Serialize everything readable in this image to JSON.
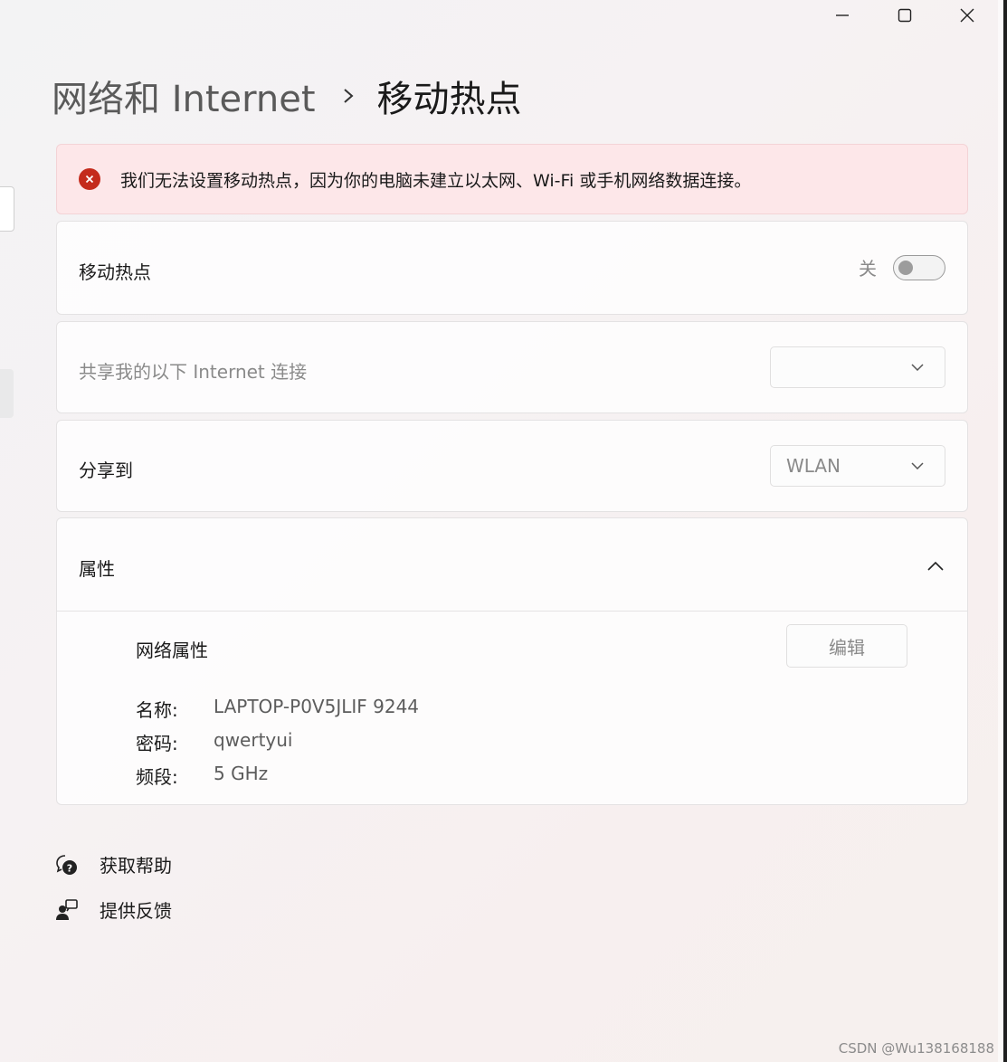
{
  "window_controls": {
    "icons": [
      "minimize-icon",
      "maximize-icon",
      "close-icon"
    ]
  },
  "breadcrumb": {
    "parent": "网络和 Internet",
    "separator_icon": "chevron-right-icon",
    "current": "移动热点"
  },
  "alert": {
    "icon": "error-icon",
    "text": "我们无法设置移动热点，因为你的电脑未建立以太网、Wi-Fi 或手机网络数据连接。",
    "color": "#c42b1c"
  },
  "hotspot": {
    "label": "移动热点",
    "toggle_state_text": "关",
    "toggle_on": false
  },
  "share_from": {
    "label": "共享我的以下 Internet 连接",
    "value": ""
  },
  "share_to": {
    "label": "分享到",
    "value": "WLAN"
  },
  "properties": {
    "label": "属性",
    "expanded": true,
    "network_properties_label": "网络属性",
    "edit_label": "编辑",
    "rows": [
      {
        "key": "名称:",
        "value": "LAPTOP-P0V5JLIF 9244"
      },
      {
        "key": "密码:",
        "value": "qwertyui"
      },
      {
        "key": "频段:",
        "value": "5 GHz"
      }
    ]
  },
  "links": {
    "help": {
      "label": "获取帮助",
      "icon": "help-chat-icon"
    },
    "feedback": {
      "label": "提供反馈",
      "icon": "feedback-icon"
    }
  },
  "watermark": "CSDN @Wu138168188"
}
